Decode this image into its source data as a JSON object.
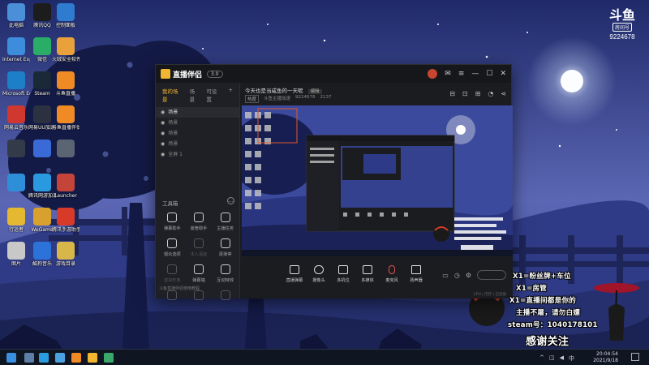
{
  "desktop": {
    "icons": [
      {
        "label": "此电脑",
        "icon": "computer-icon",
        "color": "#4a8fd8"
      },
      {
        "label": "腾讯QQ",
        "icon": "qq-icon",
        "color": "#1c1c1c"
      },
      {
        "label": "控制面板",
        "icon": "control-panel-icon",
        "color": "#2e7bcf"
      },
      {
        "label": "Internet Explorer",
        "icon": "ie-icon",
        "color": "#3e8ddd"
      },
      {
        "label": "微信",
        "icon": "wechat-icon",
        "color": "#2aae67"
      },
      {
        "label": "火绒安全软件",
        "icon": "huorong-icon",
        "color": "#e9a23b"
      },
      {
        "label": "Microsoft Edge",
        "icon": "edge-icon",
        "color": "#1d7fc7"
      },
      {
        "label": "Steam",
        "icon": "steam-icon",
        "color": "#1b2838"
      },
      {
        "label": "斗鱼直播",
        "icon": "douyu-icon",
        "color": "#f08a24"
      },
      {
        "label": "网易云音乐",
        "icon": "music-icon",
        "color": "#d0372f"
      },
      {
        "label": "网易UU加速器",
        "icon": "uu-icon",
        "color": "#2b3140"
      },
      {
        "label": "斗鱼直播伴侣",
        "icon": "douyu-companion-icon",
        "color": "#f08a24"
      },
      {
        "label": "",
        "icon": "app-icon",
        "color": "#333a4a"
      },
      {
        "label": "",
        "icon": "star-app-icon",
        "color": "#3a6ad8"
      },
      {
        "label": "",
        "icon": "tool-icon",
        "color": "#5a6472"
      },
      {
        "label": "",
        "icon": "app-icon",
        "color": "#2e8fd8"
      },
      {
        "label": "腾讯网游加速器",
        "icon": "accelerator-icon",
        "color": "#2a9ae0"
      },
      {
        "label": "Launcher",
        "icon": "launcher-icon",
        "color": "#c4443a"
      },
      {
        "label": "行运者",
        "icon": "cat-icon",
        "color": "#e4b830"
      },
      {
        "label": "WeGame",
        "icon": "wegame-icon",
        "color": "#d8a12e"
      },
      {
        "label": "腾讯手游助手",
        "icon": "mobile-assistant-icon",
        "color": "#d83a2a"
      },
      {
        "label": "图片",
        "icon": "picture-icon",
        "color": "#c8c8c8"
      },
      {
        "label": "酷狗音乐",
        "icon": "kugou-icon",
        "color": "#2b73d8"
      },
      {
        "label": "游戏目录",
        "icon": "folder-icon",
        "color": "#d8b64a"
      }
    ]
  },
  "room_badge": {
    "logo": "斗鱼",
    "tag": "房间号",
    "number": "9224678"
  },
  "app": {
    "name": "直播伴侣",
    "version": "3.0",
    "left_tabs": [
      "我的场景",
      "场景",
      "可设置"
    ],
    "scenes": [
      {
        "label": "场景"
      },
      {
        "label": "场景"
      },
      {
        "label": "场景"
      },
      {
        "label": "场景"
      },
      {
        "label": "全屏 1"
      }
    ],
    "tools_title": "工具箱",
    "tools": [
      {
        "label": "弹幕助手",
        "dim": false
      },
      {
        "label": "房管助手",
        "dim": false
      },
      {
        "label": "主播任务",
        "dim": false
      },
      {
        "label": "观众选项",
        "dim": false
      },
      {
        "label": "本人语音",
        "dim": true
      },
      {
        "label": "逐渐停",
        "dim": false
      },
      {
        "label": "虚拟形象",
        "dim": true
      },
      {
        "label": "弹幕墙",
        "dim": false
      },
      {
        "label": "互动特效",
        "dim": false
      },
      {
        "label": "",
        "dim": true
      },
      {
        "label": "",
        "dim": true
      },
      {
        "label": "",
        "dim": true
      }
    ],
    "left_notice": "斗鱼直播伴侣使用教程",
    "stream_title": "今天也是当咸鱼的一天呢",
    "edit_label": "编辑",
    "meta_chip": "热度",
    "meta_items": [
      "斗鱼主播加速",
      "9224678",
      "2137"
    ],
    "bottom_items": [
      "直播弹幕",
      "摄像头",
      "多机位",
      "多媒体",
      "麦克风",
      "扬声器"
    ],
    "status_text": "CPU  |  内存  |  已连接"
  },
  "overlay": {
    "lines": [
      "X1=粉丝牌+车位",
      "X1=房管",
      "X1=直播间都是你的",
      "主播不屠，请勿白嫖",
      "steam号：1040178101"
    ],
    "thanks": "感谢关注"
  },
  "taskbar": {
    "time": "20:04:54",
    "date": "2021/9/18",
    "apps": [
      {
        "icon": "windows-start-icon",
        "color": "#3a8fe0"
      },
      {
        "icon": "steam-taskbar-icon",
        "color": "#5d7ea6"
      },
      {
        "icon": "edge-taskbar-icon",
        "color": "#2b9be0"
      },
      {
        "icon": "qq-taskbar-icon",
        "color": "#4aa3e0"
      },
      {
        "icon": "douyu-taskbar-icon",
        "color": "#f08a24"
      },
      {
        "icon": "companion-taskbar-icon",
        "color": "#f2b531"
      },
      {
        "icon": "wechat-taskbar-icon",
        "color": "#3aa86b"
      }
    ]
  }
}
